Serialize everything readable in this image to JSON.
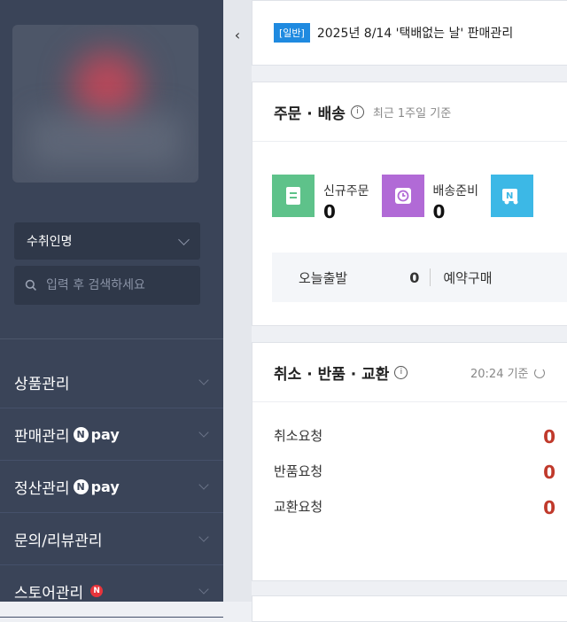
{
  "sidebar": {
    "store_select": "수취인명",
    "search_placeholder": "입력 후 검색하세요",
    "menu": [
      {
        "label": "상품관리",
        "badge": ""
      },
      {
        "label": "판매관리",
        "badge": "npay"
      },
      {
        "label": "정산관리",
        "badge": "npay"
      },
      {
        "label": "문의/리뷰관리",
        "badge": ""
      },
      {
        "label": "스토어관리",
        "badge": "N"
      }
    ],
    "npay_text": "pay",
    "npay_n": "N"
  },
  "notice": {
    "tag": "[일반]",
    "text": "2025년 8/14 '택배없는 날' 판매관리"
  },
  "orders": {
    "title": "주문 · 배송",
    "subtitle": "최근 1주일 기준",
    "stats": [
      {
        "label": "신규주문",
        "value": "0",
        "color": "#5ec28a"
      },
      {
        "label": "배송준비",
        "value": "0",
        "color": "#b16ad6"
      },
      {
        "label": "",
        "value": "",
        "color": "#3cb8e6"
      }
    ],
    "today_label": "오늘출발",
    "today_value": "0",
    "reserve_label": "예약구매"
  },
  "cancel": {
    "title": "취소 · 반품 · 교환",
    "time": "20:24 기준",
    "rows": [
      {
        "label": "취소요청",
        "value": "0"
      },
      {
        "label": "반품요청",
        "value": "0"
      },
      {
        "label": "교환요청",
        "value": "0"
      }
    ]
  }
}
